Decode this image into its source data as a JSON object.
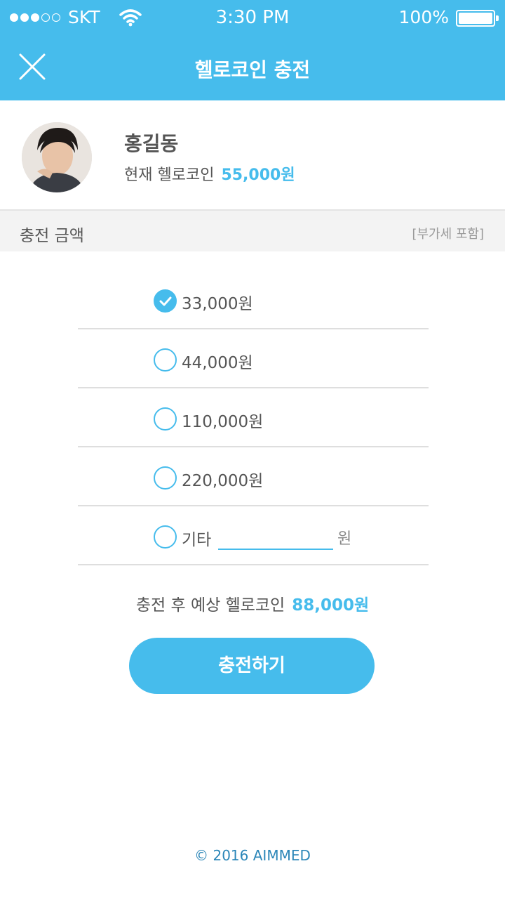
{
  "status_bar": {
    "carrier": "SKT",
    "signal_bars": 3,
    "time": "3:30 PM",
    "battery_percent": "100%"
  },
  "header": {
    "title": "헬로코인 충전",
    "close_icon": "close-icon"
  },
  "profile": {
    "name": "홍길동",
    "coin_label": "현재 헬로코인",
    "coin_amount": "55,000원"
  },
  "section": {
    "title": "충전 금액",
    "note": "[부가세 포함]"
  },
  "options": [
    {
      "label": "33,000원",
      "checked": true
    },
    {
      "label": "44,000원",
      "checked": false
    },
    {
      "label": "110,000원",
      "checked": false
    },
    {
      "label": "220,000원",
      "checked": false
    }
  ],
  "other_option": {
    "label": "기타",
    "value": "",
    "suffix": "원",
    "checked": false
  },
  "expected": {
    "label": "충전 후 예상 헬로코인",
    "amount": "88,000원"
  },
  "charge_button": {
    "label": "충전하기"
  },
  "footer": {
    "copyright": "© 2016 AIMMED"
  },
  "colors": {
    "accent": "#46bcec",
    "footer_text": "#2b86b8"
  }
}
